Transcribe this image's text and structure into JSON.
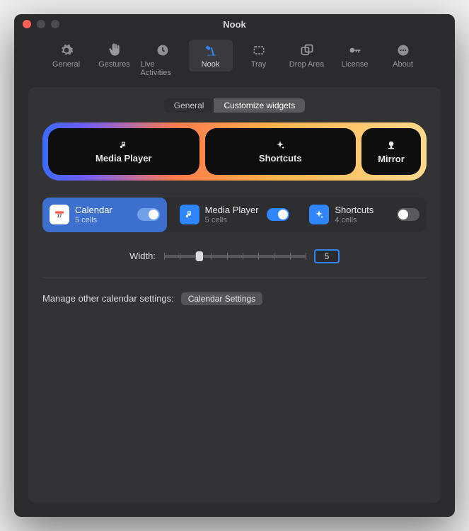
{
  "window": {
    "title": "Nook"
  },
  "toolbar": {
    "items": [
      {
        "label": "General",
        "icon": "gear"
      },
      {
        "label": "Gestures",
        "icon": "hand"
      },
      {
        "label": "Live Activities",
        "icon": "clock"
      },
      {
        "label": "Nook",
        "icon": "lamp",
        "selected": true
      },
      {
        "label": "Tray",
        "icon": "tray"
      },
      {
        "label": "Drop Area",
        "icon": "droparea"
      },
      {
        "label": "License",
        "icon": "key"
      },
      {
        "label": "About",
        "icon": "ellipsis"
      }
    ]
  },
  "tabs": {
    "items": [
      {
        "label": "General"
      },
      {
        "label": "Customize widgets",
        "selected": true
      }
    ]
  },
  "preview": {
    "chips": [
      {
        "label": "Media Player",
        "icon": "note"
      },
      {
        "label": "Shortcuts",
        "icon": "sparkle"
      },
      {
        "label": "Mirror",
        "icon": "camera"
      }
    ]
  },
  "widgets": [
    {
      "name": "Calendar",
      "cells": "5 cells",
      "on": true,
      "selected": true,
      "icon": "calendar"
    },
    {
      "name": "Media Player",
      "cells": "5 cells",
      "on": true,
      "icon": "note"
    },
    {
      "name": "Shortcuts",
      "cells": "4 cells",
      "on": false,
      "icon": "sparkle"
    }
  ],
  "width": {
    "label": "Width:",
    "value": "5",
    "min": 1,
    "max": 10,
    "pos": 0.25
  },
  "settings": {
    "label": "Manage other calendar settings:",
    "button": "Calendar Settings"
  }
}
